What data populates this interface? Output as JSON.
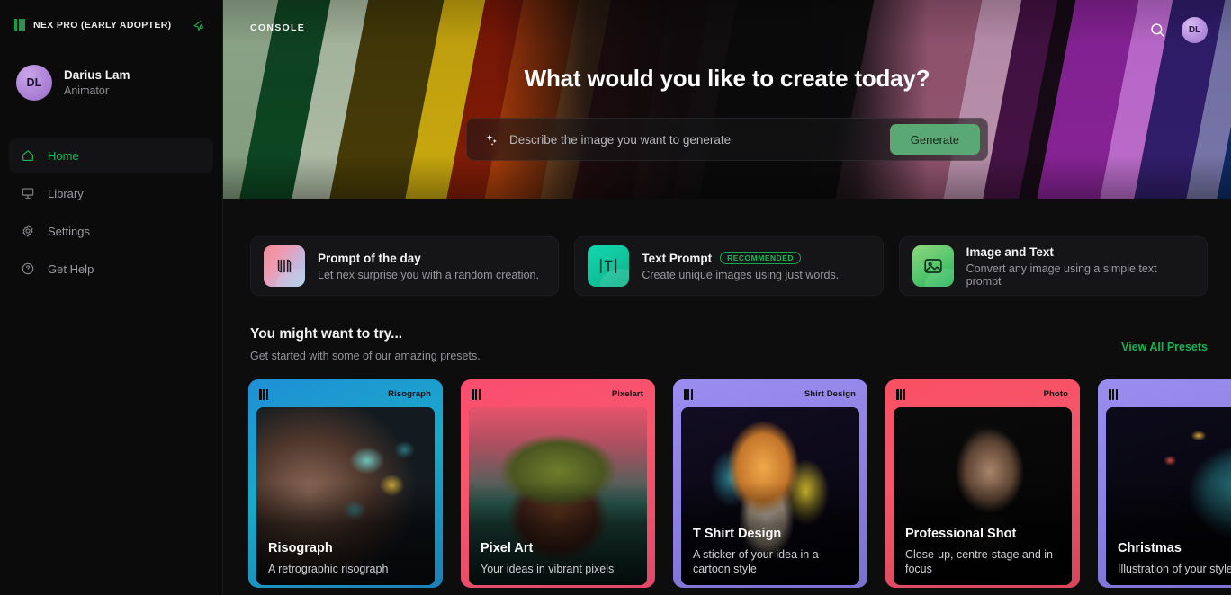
{
  "sidebar": {
    "brand": "NEX PRO (EARLY ADOPTER)",
    "collapse_icon": "collapse-arrow-icon",
    "user": {
      "initials": "DL",
      "name": "Darius Lam",
      "role": "Animator"
    },
    "nav": [
      {
        "label": "Home",
        "icon": "home-icon",
        "active": true
      },
      {
        "label": "Library",
        "icon": "library-board-icon",
        "active": false
      },
      {
        "label": "Settings",
        "icon": "gear-icon",
        "active": false
      },
      {
        "label": "Get Help",
        "icon": "question-circle-icon",
        "active": false
      }
    ]
  },
  "hero": {
    "console_label": "CONSOLE",
    "title": "What would you like to create today?",
    "search_icon": "search-icon",
    "avatar_initials": "DL",
    "prompt": {
      "icon": "sparkle-icon",
      "value": "",
      "placeholder": "Describe the image you want to generate",
      "button_label": "Generate"
    }
  },
  "action_cards": [
    {
      "icon": "nex-logo-icon",
      "title": "Prompt of the day",
      "badge": "",
      "desc": "Let nex surprise you with a random creation."
    },
    {
      "icon": "text-prompt-icon",
      "title": "Text Prompt",
      "badge": "RECOMMENDED",
      "desc": "Create unique images using just words."
    },
    {
      "icon": "image-icon",
      "title": "Image and Text",
      "badge": "",
      "desc": "Convert any image using a simple text prompt"
    }
  ],
  "presets": {
    "title": "You might want to try...",
    "subtitle": "Get started with some of our amazing presets.",
    "view_all": "View All Presets",
    "items": [
      {
        "tag": "Risograph",
        "name": "Risograph",
        "desc": "A retrographic risograph"
      },
      {
        "tag": "Pixelart",
        "name": "Pixel Art",
        "desc": "Your ideas in vibrant pixels"
      },
      {
        "tag": "Shirt Design",
        "name": "T Shirt Design",
        "desc": "A sticker of your idea in a cartoon style"
      },
      {
        "tag": "Photo",
        "name": "Professional Shot",
        "desc": "Close-up, centre-stage and in focus"
      },
      {
        "tag": "",
        "name": "Christmas",
        "desc": "Illustration of your style"
      }
    ]
  },
  "colors": {
    "accent_green": "#19b85c",
    "generate_button": "#5aa873",
    "sidebar_bg": "#0b0b0c",
    "page_bg": "#0d0d0e",
    "card_bg": "#151517"
  }
}
